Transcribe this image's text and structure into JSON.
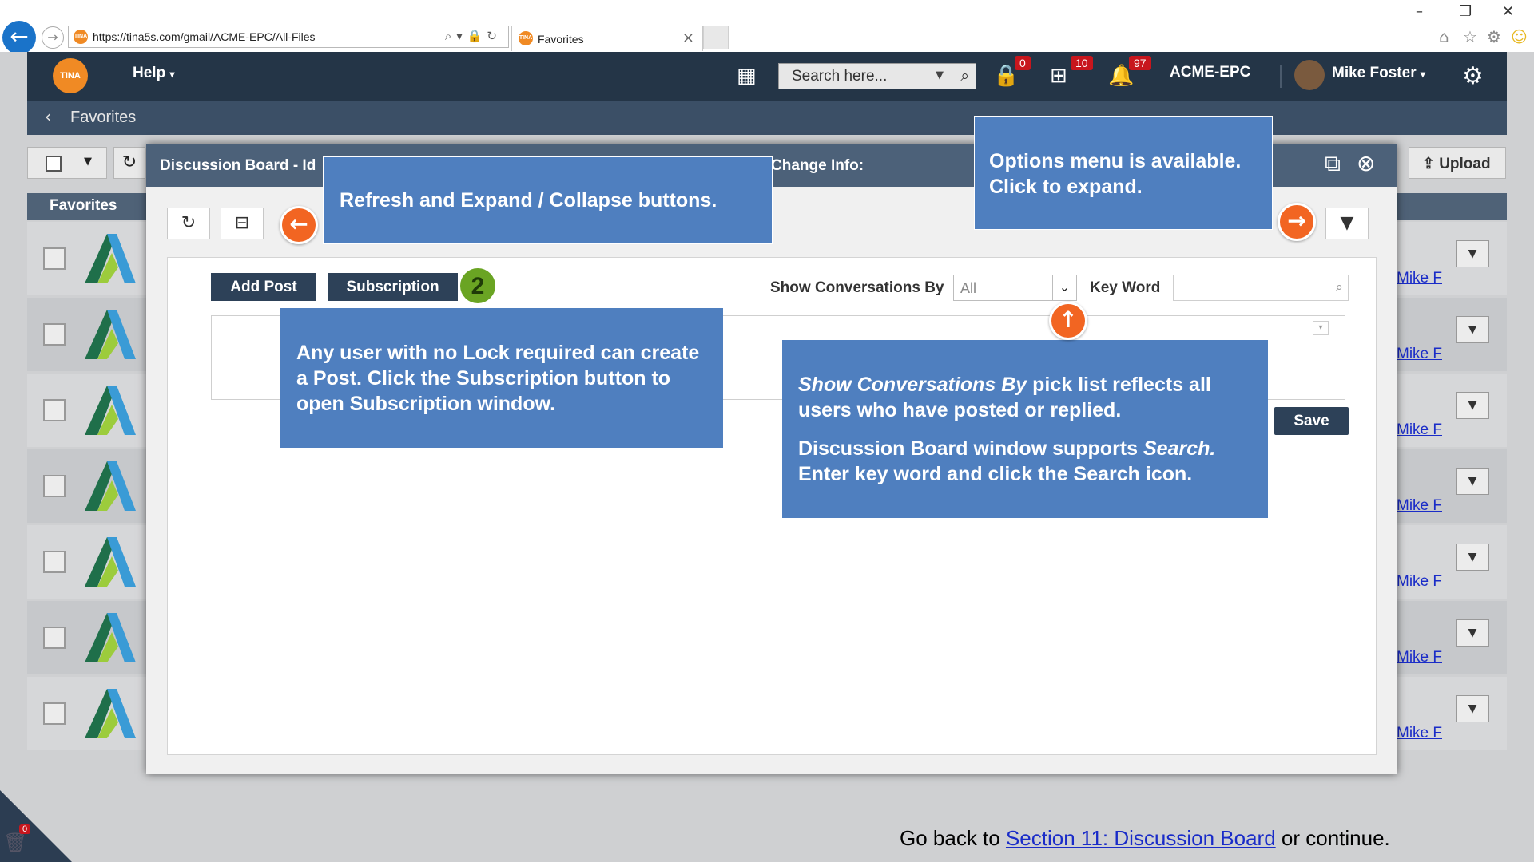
{
  "browser": {
    "url": "https://tina5s.com/gmail/ACME-EPC/All-Files",
    "tab_title": "Favorites",
    "tab_close": "×",
    "window_controls": [
      "–",
      "❐",
      "✕"
    ]
  },
  "app": {
    "logo_text": "TINA",
    "help_label": "Help",
    "search_placeholder": "Search here...",
    "badges": {
      "lock": "0",
      "org": "10",
      "bell": "97"
    },
    "org_name": "ACME-EPC",
    "user_name": "Mike Foster",
    "breadcrumb": "Favorites",
    "favorites_header": "Favorites",
    "upload_label": "Upload",
    "row_link_text": "Mike F",
    "trash_badge": "0"
  },
  "modal": {
    "title": "Discussion Board - Id",
    "change_info": "Change Info:",
    "add_post_label": "Add Post",
    "subscription_label": "Subscription",
    "show_by_label": "Show Conversations By",
    "show_by_value": "All",
    "keyword_label": "Key Word",
    "save_label": "Save"
  },
  "callouts": {
    "refresh_expand": "Refresh and Expand / Collapse buttons.",
    "options_menu": "Options menu is available. Click to expand.",
    "add_post_info": "Any user with no Lock required can create a Post. Click the Subscription button to open Subscription window.",
    "show_by_info_em": "Show Conversations By",
    "show_by_info_rest": " pick list reflects all users who have posted or replied.",
    "search_info_a": "Discussion Board window supports ",
    "search_info_em": "Search.",
    "search_info_b": " Enter key word and click the Search icon.",
    "step_number": "2"
  },
  "footer": {
    "prefix": "Go back to ",
    "link": "Section 11: Discussion Board",
    "suffix": " or continue."
  },
  "colors": {
    "topbar": "#243547",
    "callout": "#4f7fbf",
    "arrow": "#f26522",
    "step_badge": "#6aa423",
    "primary_button": "#2d4158"
  }
}
